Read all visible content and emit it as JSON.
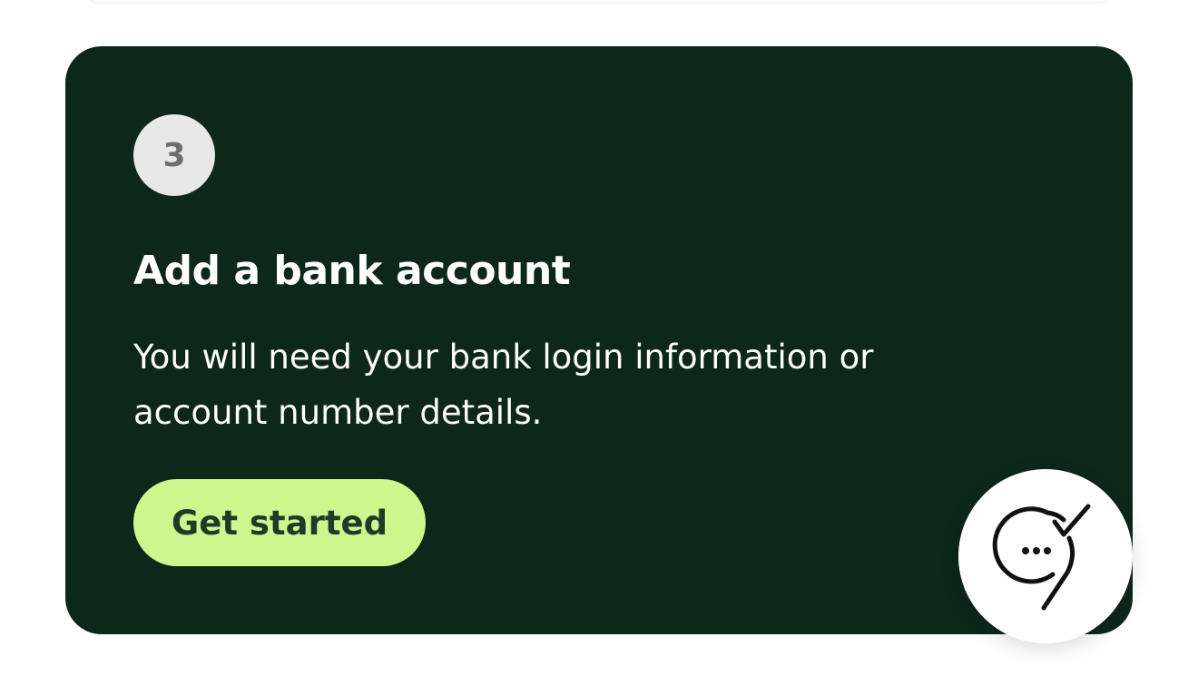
{
  "step": {
    "number": "3",
    "title": "Add a bank account",
    "description": "You will need your bank login information or account number details.",
    "cta_label": "Get started"
  },
  "chat": {
    "icon": "chat-check-icon"
  },
  "colors": {
    "card_background": "#0d271b",
    "badge_background": "#e8e8e8",
    "badge_text": "#6e6e6e",
    "cta_background": "#ccf78c",
    "cta_text": "#1f3b28",
    "text": "#ffffff"
  }
}
